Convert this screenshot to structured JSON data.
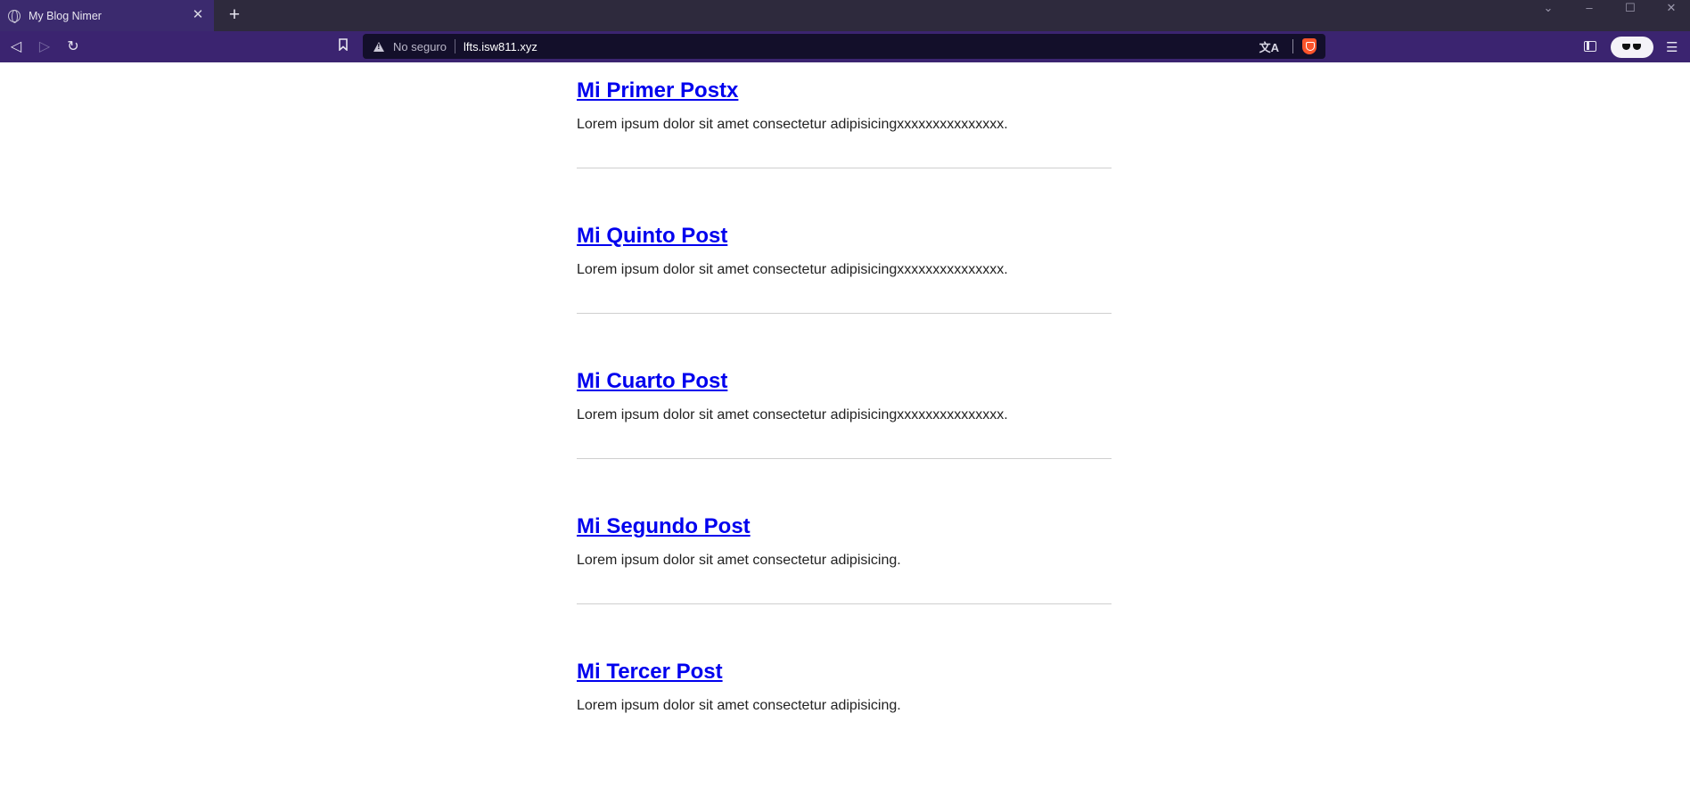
{
  "browser": {
    "tab": {
      "title": "My Blog Nimer",
      "close_label": "✕"
    },
    "newtab_label": "+",
    "window_controls": {
      "chevron": "⌄",
      "minimize": "–",
      "maximize": "☐",
      "close": "✕"
    },
    "toolbar": {
      "back": "◁",
      "forward": "▷",
      "reload": "↻",
      "bookmark": "🔖",
      "security_text": "No seguro",
      "url": "lfts.isw811.xyz",
      "translate": "文A",
      "menu": "☰"
    }
  },
  "posts": [
    {
      "title": "Mi Primer Postx",
      "excerpt": "Lorem ipsum dolor sit amet consectetur adipisicingxxxxxxxxxxxxxxx."
    },
    {
      "title": "Mi Quinto Post",
      "excerpt": "Lorem ipsum dolor sit amet consectetur adipisicingxxxxxxxxxxxxxxx."
    },
    {
      "title": "Mi Cuarto Post",
      "excerpt": "Lorem ipsum dolor sit amet consectetur adipisicingxxxxxxxxxxxxxxx."
    },
    {
      "title": "Mi Segundo Post",
      "excerpt": "Lorem ipsum dolor sit amet consectetur adipisicing."
    },
    {
      "title": "Mi Tercer Post",
      "excerpt": "Lorem ipsum dolor sit amet consectetur adipisicing."
    }
  ],
  "colors": {
    "tabstrip": "#2e2a3d",
    "active_tab": "#3b2a6e",
    "toolbar": "#3b2470",
    "omnibox": "#130f2a",
    "link": "#0000ee"
  }
}
